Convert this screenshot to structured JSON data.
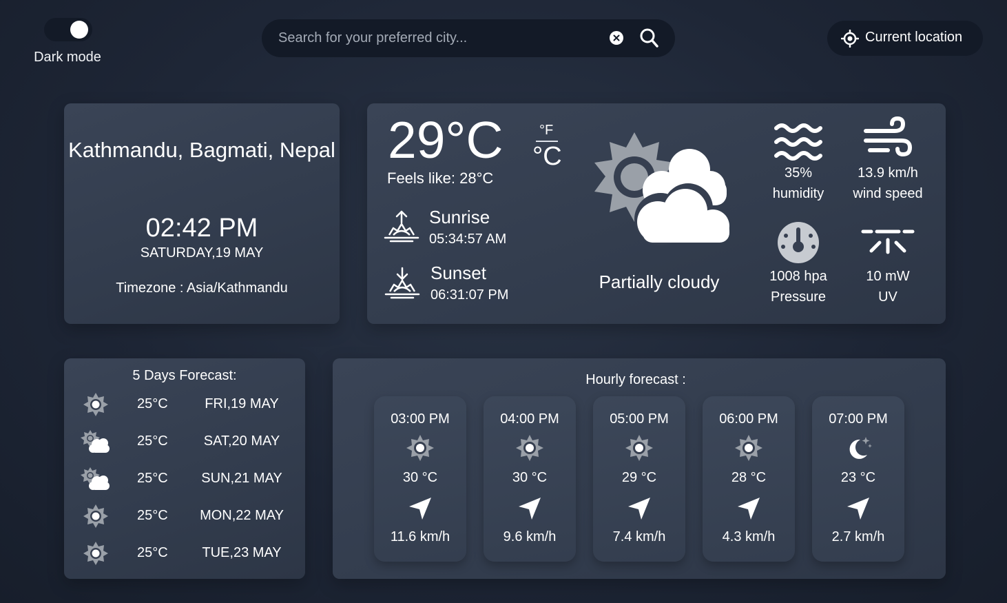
{
  "header": {
    "dark_mode_label": "Dark mode",
    "search_placeholder": "Search for your preferred city...",
    "location_button_label": "Current location"
  },
  "location": {
    "city": "Kathmandu, Bagmati, Nepal",
    "time": "02:42 PM",
    "date": "SATURDAY,19 MAY",
    "timezone": "Timezone : Asia/Kathmandu"
  },
  "current": {
    "temperature": "29°C",
    "unit_f": "°F",
    "unit_c": "°C",
    "feels_like": "Feels like: 28°C",
    "sunrise_label": "Sunrise",
    "sunrise_time": "05:34:57 AM",
    "sunset_label": "Sunset",
    "sunset_time": "06:31:07 PM",
    "condition": "Partially cloudy",
    "stats": {
      "humidity_value": "35%",
      "humidity_label": "humidity",
      "wind_value": "13.9 km/h",
      "wind_label": "wind speed",
      "pressure_value": "1008 hpa",
      "pressure_label": "Pressure",
      "uv_value": "10 mW",
      "uv_label": "UV"
    }
  },
  "five_day": {
    "title": "5 Days Forecast:",
    "days": [
      {
        "icon": "sun-icon",
        "temp": "25°C",
        "date": "FRI,19 MAY"
      },
      {
        "icon": "sun-cloud-icon",
        "temp": "25°C",
        "date": "SAT,20 MAY"
      },
      {
        "icon": "sun-cloud-icon",
        "temp": "25°C",
        "date": "SUN,21 MAY"
      },
      {
        "icon": "sun-icon",
        "temp": "25°C",
        "date": "MON,22 MAY"
      },
      {
        "icon": "sun-icon",
        "temp": "25°C",
        "date": "TUE,23 MAY"
      }
    ]
  },
  "hourly": {
    "title": "Hourly forecast :",
    "hours": [
      {
        "time": "03:00 PM",
        "icon": "sun-icon",
        "temp": "30 °C",
        "wind": "11.6 km/h"
      },
      {
        "time": "04:00 PM",
        "icon": "sun-icon",
        "temp": "30 °C",
        "wind": "9.6 km/h"
      },
      {
        "time": "05:00 PM",
        "icon": "sun-icon",
        "temp": "29 °C",
        "wind": "7.4 km/h"
      },
      {
        "time": "06:00 PM",
        "icon": "sun-icon",
        "temp": "28 °C",
        "wind": "4.3 km/h"
      },
      {
        "time": "07:00 PM",
        "icon": "moon-icon",
        "temp": "23 °C",
        "wind": "2.7 km/h"
      }
    ]
  },
  "colors": {
    "background": "#1e2636",
    "card": "#363f50",
    "pill": "#131a27",
    "icon_gray": "#9aa0a8",
    "text": "#ffffff"
  }
}
